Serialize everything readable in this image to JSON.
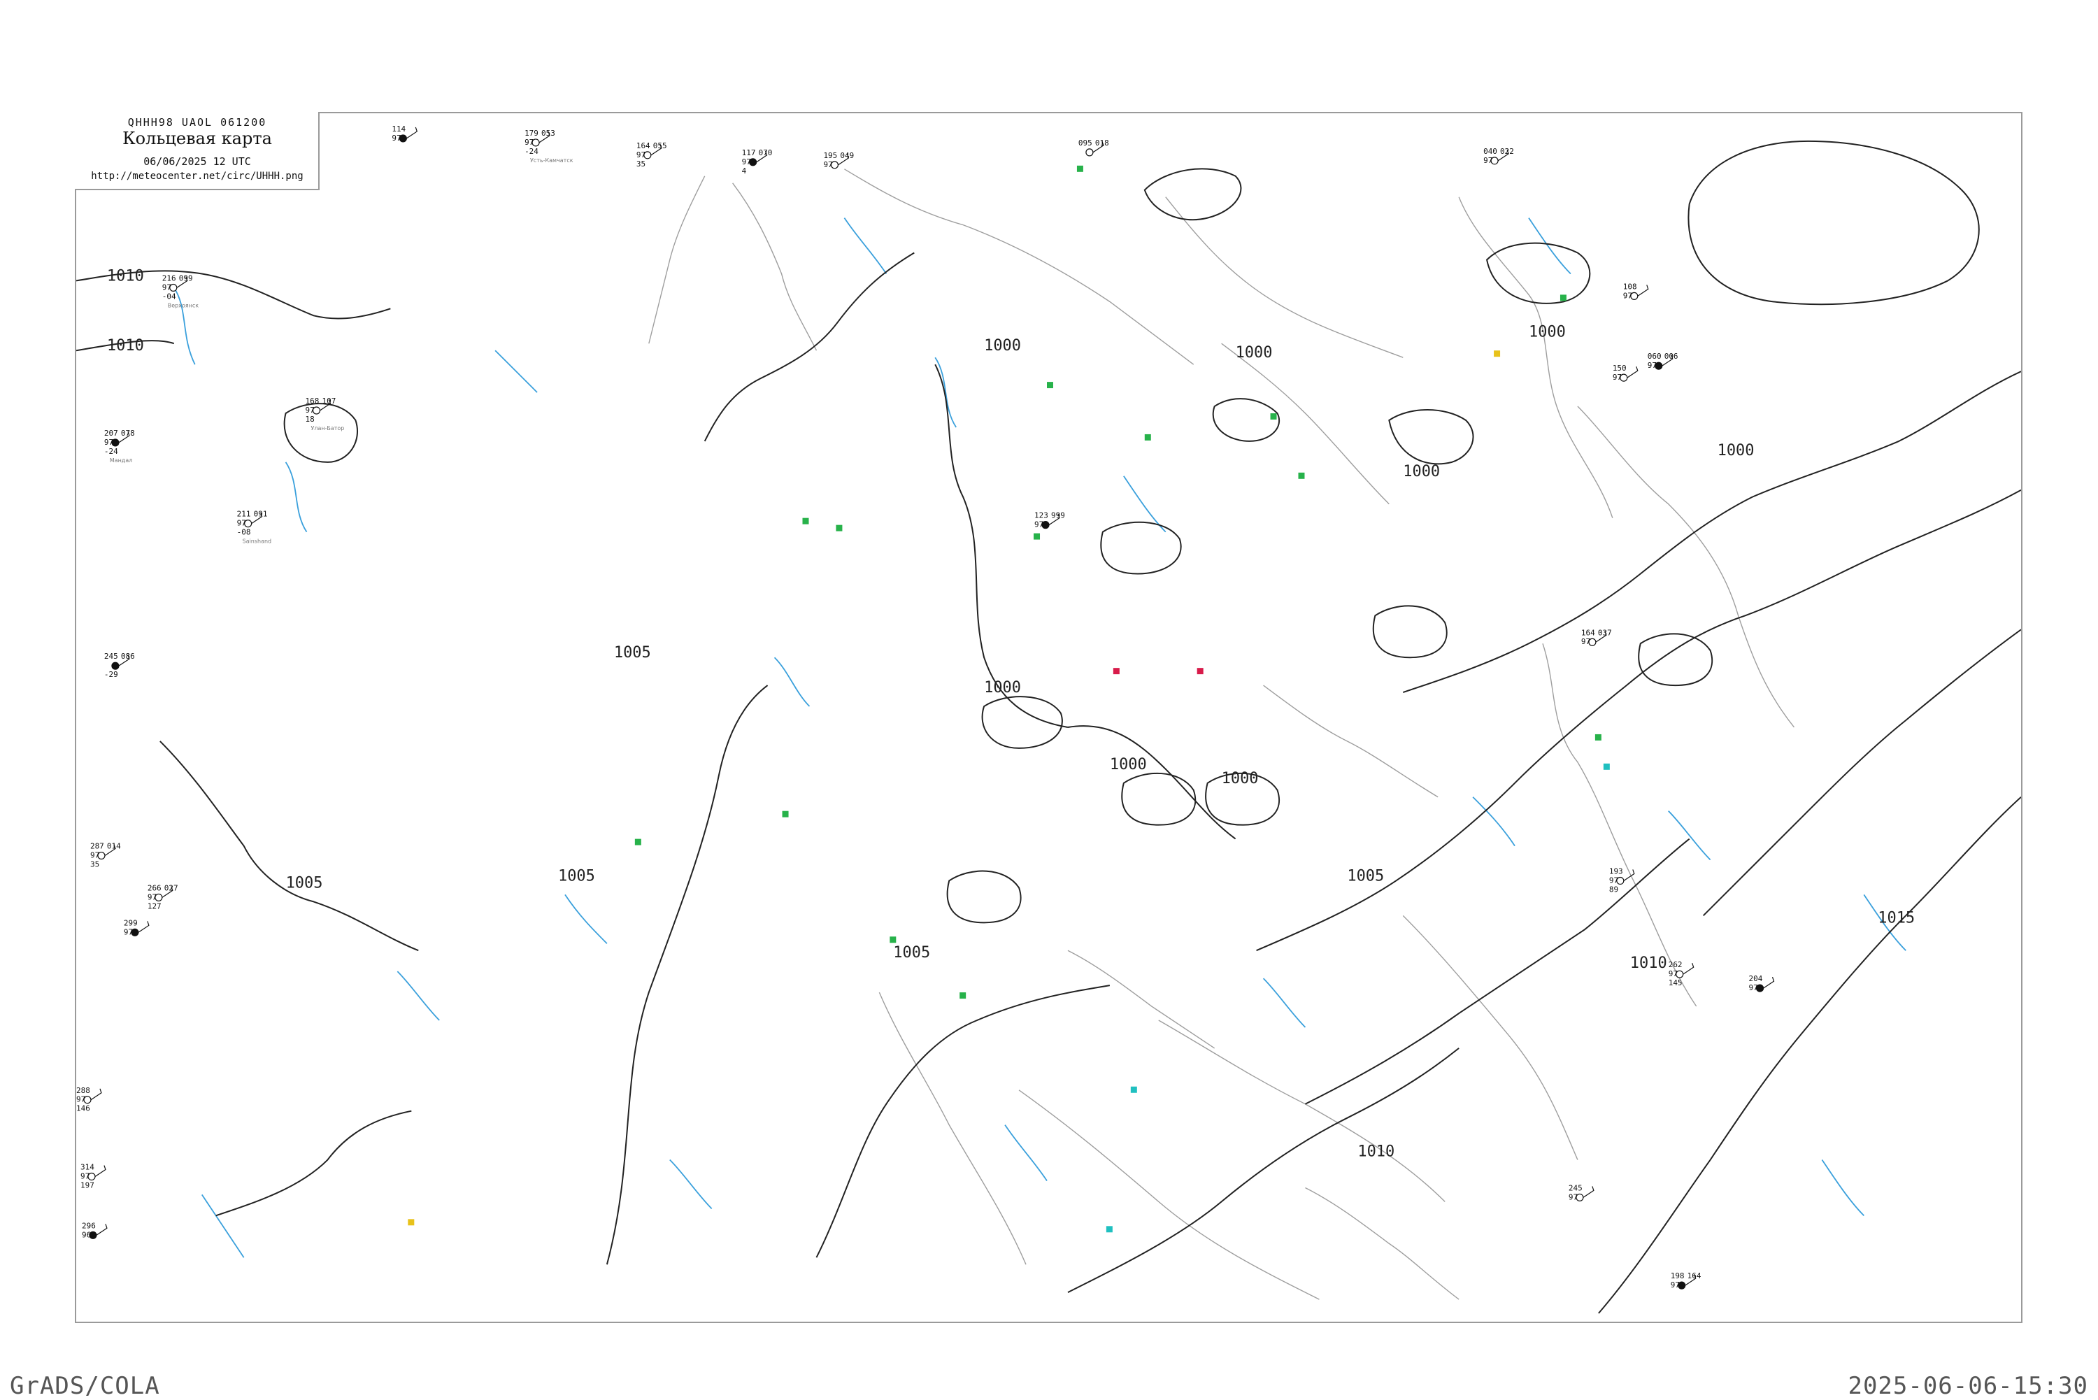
{
  "header": {
    "codes": "QHHH98  UAOL  061200",
    "title": "Кольцевая карта",
    "date": "06/06/2025 12 UTC",
    "url": "http://meteocenter.net/circ/UHHH.png"
  },
  "footer": {
    "left": "GrADS/COLA",
    "right": "2025-06-06-15:30"
  },
  "colors": {
    "isobar": "#222222",
    "coast": "#9e9e9e",
    "river": "#3aa0dc",
    "precip_green": "#27b24a",
    "precip_red": "#d81b4a",
    "precip_yellow": "#e8c21a",
    "precip_cyan": "#20c0c0"
  },
  "isobar_labels": [
    "1010",
    "1010",
    "1000",
    "1000",
    "1000",
    "1000",
    "1000",
    "1000",
    "1000",
    "1000",
    "1005",
    "1005",
    "1005",
    "1005",
    "1005",
    "1010",
    "1010",
    "1015"
  ],
  "stations": [
    {
      "top": "114",
      "mid": "97",
      "bot": "",
      "right": "",
      "name": ""
    },
    {
      "top": "179",
      "mid": "97",
      "bot": "-24",
      "right": "053",
      "name": "Усть-Камчатск"
    },
    {
      "top": "164",
      "mid": "97",
      "bot": "35",
      "right": "055",
      "name": ""
    },
    {
      "top": "117",
      "mid": "97",
      "bot": "4",
      "right": "070",
      "name": ""
    },
    {
      "top": "195",
      "mid": "97",
      "bot": "",
      "right": "049",
      "name": ""
    },
    {
      "top": "216",
      "mid": "97",
      "bot": "-04",
      "right": "099",
      "name": "Верхоянск"
    },
    {
      "top": "207",
      "mid": "97",
      "bot": "-24",
      "right": "078",
      "name": "Мандал"
    },
    {
      "top": "168",
      "mid": "97",
      "bot": "18",
      "right": "107",
      "name": "Улан-Батор"
    },
    {
      "top": "211",
      "mid": "97",
      "bot": "-08",
      "right": "091",
      "name": "Sainshand"
    },
    {
      "top": "245",
      "mid": "",
      "bot": "-29",
      "right": "086",
      "name": ""
    },
    {
      "top": "287",
      "mid": "97",
      "bot": "35",
      "right": "014",
      "name": ""
    },
    {
      "top": "266",
      "mid": "97",
      "bot": "127",
      "right": "027",
      "name": ""
    },
    {
      "top": "299",
      "mid": "97",
      "bot": "",
      "right": "",
      "name": ""
    },
    {
      "top": "288",
      "mid": "97",
      "bot": "146",
      "right": "",
      "name": ""
    },
    {
      "top": "314",
      "mid": "97",
      "bot": "197",
      "right": "",
      "name": ""
    },
    {
      "top": "296",
      "mid": "96",
      "bot": "",
      "right": "",
      "name": ""
    },
    {
      "top": "108",
      "mid": "97",
      "bot": "",
      "right": "",
      "name": ""
    },
    {
      "top": "150",
      "mid": "97",
      "bot": "",
      "right": "",
      "name": ""
    },
    {
      "top": "123",
      "mid": "97",
      "bot": "",
      "right": "999",
      "name": ""
    },
    {
      "top": "095",
      "mid": "",
      "bot": "",
      "right": "018",
      "name": ""
    },
    {
      "top": "040",
      "mid": "97",
      "bot": "",
      "right": "022",
      "name": ""
    },
    {
      "top": "060",
      "mid": "97",
      "bot": "",
      "right": "006",
      "name": ""
    },
    {
      "top": "164",
      "mid": "97",
      "bot": "",
      "right": "037",
      "name": ""
    },
    {
      "top": "193",
      "mid": "97",
      "bot": "89",
      "right": "",
      "name": ""
    },
    {
      "top": "198",
      "mid": "97",
      "bot": "",
      "right": "164",
      "name": ""
    },
    {
      "top": "245",
      "mid": "97",
      "bot": "",
      "right": "",
      "name": ""
    },
    {
      "top": "262",
      "mid": "97",
      "bot": "145",
      "right": "",
      "name": ""
    },
    {
      "top": "204",
      "mid": "97",
      "bot": "",
      "right": "",
      "name": ""
    }
  ]
}
